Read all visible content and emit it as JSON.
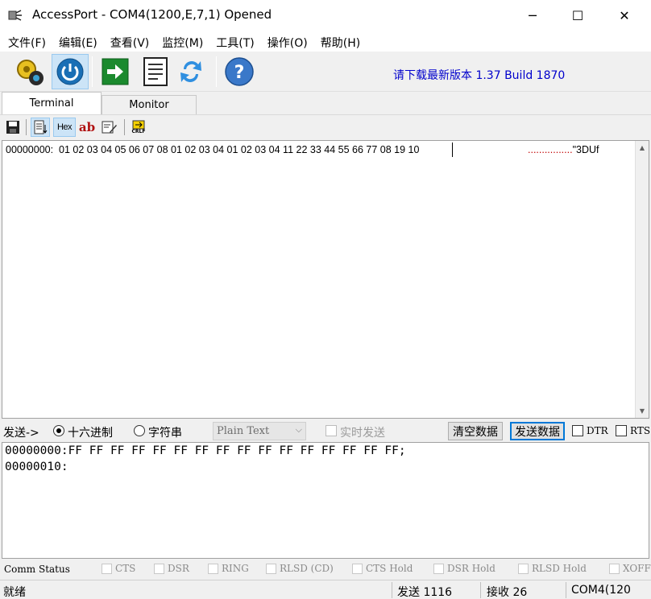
{
  "window": {
    "title": "AccessPort - COM4(1200,E,7,1) Opened",
    "minimize": "─",
    "maximize": "☐",
    "close": "✕"
  },
  "menu": [
    "文件(F)",
    "编辑(E)",
    "查看(V)",
    "监控(M)",
    "工具(T)",
    "操作(O)",
    "帮助(H)"
  ],
  "toolbar": {
    "icons": [
      "config-gear-icon",
      "power-icon",
      "run-arrow-icon",
      "notepad-icon",
      "refresh-icon",
      "help-icon"
    ],
    "help_glyph": "?",
    "update_notice": "请下载最新版本 1.37 Build 1870"
  },
  "tabs": [
    "Terminal",
    "Monitor"
  ],
  "subtoolbar": {
    "hex_label": "Hex",
    "ab_label": "ab",
    "crlf_label": "CRLF"
  },
  "receive": {
    "line": "00000000:  01 02 03 04 05 06 07 08 01 02 03 04 01 02 03 04 11 22 33 44 55 66 77 08 19 10",
    "ascii": "................\"3DUf"
  },
  "send_bar": {
    "label": "发送->",
    "radio_hex": "十六进制",
    "radio_string": "字符串",
    "format_select": "Plain Text",
    "realtime_label": "实时发送",
    "clear_button": "清空数据",
    "send_button": "发送数据",
    "dtr_label": "DTR",
    "rts_label": "RTS"
  },
  "send_area": {
    "lines": [
      "00000000:FF FF FF FF FF FF FF FF FF FF FF FF FF FF FF FF;",
      "00000010:"
    ]
  },
  "comm_status": {
    "label": "Comm Status",
    "signals": [
      "CTS",
      "DSR",
      "RING",
      "RLSD (CD)",
      "CTS Hold",
      "DSR Hold",
      "RLSD Hold",
      "XOFF"
    ]
  },
  "statusbar": {
    "ready": "就绪",
    "sent": "发送 1116",
    "received": "接收 26",
    "port": "COM4(120"
  }
}
